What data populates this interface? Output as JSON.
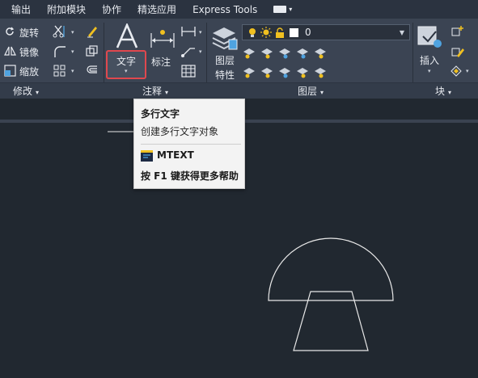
{
  "menu": {
    "items": [
      "输出",
      "附加模块",
      "协作",
      "精选应用",
      "Express Tools"
    ]
  },
  "modify": {
    "rotate": "旋转",
    "mirror": "镜像",
    "scale": "缩放",
    "panel_label": "修改"
  },
  "annotation": {
    "text_label": "文字",
    "dimension_label": "标注",
    "panel_label": "注释"
  },
  "layers": {
    "properties_label_line1": "图层",
    "properties_label_line2": "特性",
    "current_layer": "0",
    "panel_label": "图层"
  },
  "block": {
    "insert_label": "插入",
    "panel_label": "块"
  },
  "tooltip": {
    "title": "多行文字",
    "description": "创建多行文字对象",
    "command": "MTEXT",
    "help": "按 F1 键获得更多帮助"
  },
  "colors": {
    "canvas_bg": "#212830",
    "ribbon_bg": "#3b4453",
    "highlight_border": "#e0484e",
    "accent_yellow": "#f0c020",
    "drawing_stroke": "#e8e8e8"
  },
  "icons": [
    "rotate-icon",
    "mirror-icon",
    "scale-icon",
    "trim-icon",
    "fillet-icon",
    "array-icon",
    "offset-icon",
    "copy-icon",
    "erase-icon",
    "text-icon",
    "dimension-icon",
    "linear-dim-icon",
    "leader-icon",
    "table-icon",
    "layer-properties-icon",
    "insert-block-icon",
    "lightbulb-icon",
    "sun-icon",
    "lock-icon",
    "mtext-command-icon"
  ]
}
